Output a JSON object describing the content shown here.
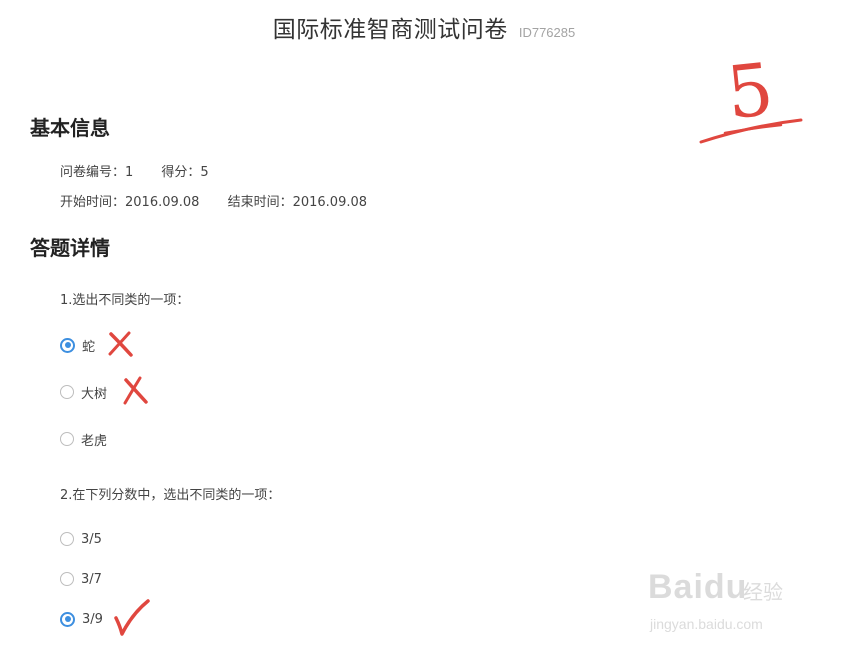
{
  "header": {
    "title": "国际标准智商测试问卷",
    "survey_id": "ID776285"
  },
  "score_mark": {
    "value": "5",
    "color": "#e0473f"
  },
  "basic_info": {
    "heading": "基本信息",
    "survey_no": "问卷编号：1",
    "score": "得分：5",
    "start_time": "开始时间：2016.09.08",
    "end_time": "结束时间：2016.09.08"
  },
  "answers": {
    "heading": "答题详情",
    "questions": [
      {
        "text": "1.选出不同类的一项：",
        "options": [
          {
            "label": "蛇",
            "selected": true,
            "mark": "cross"
          },
          {
            "label": "大树",
            "selected": false,
            "mark": "cross"
          },
          {
            "label": "老虎",
            "selected": false,
            "mark": ""
          }
        ]
      },
      {
        "text": "2.在下列分数中，选出不同类的一项：",
        "options": [
          {
            "label": "3/5",
            "selected": false,
            "mark": ""
          },
          {
            "label": "3/7",
            "selected": false,
            "mark": ""
          },
          {
            "label": "3/9",
            "selected": true,
            "mark": "check"
          }
        ]
      }
    ]
  },
  "colors": {
    "accent": "#3d8fe0",
    "mark_red": "#e0473f",
    "heading": "#222222",
    "text": "#444444"
  },
  "watermark": {
    "logo": "Baidu",
    "brand": "经验",
    "url": "jingyan.baidu.com"
  }
}
